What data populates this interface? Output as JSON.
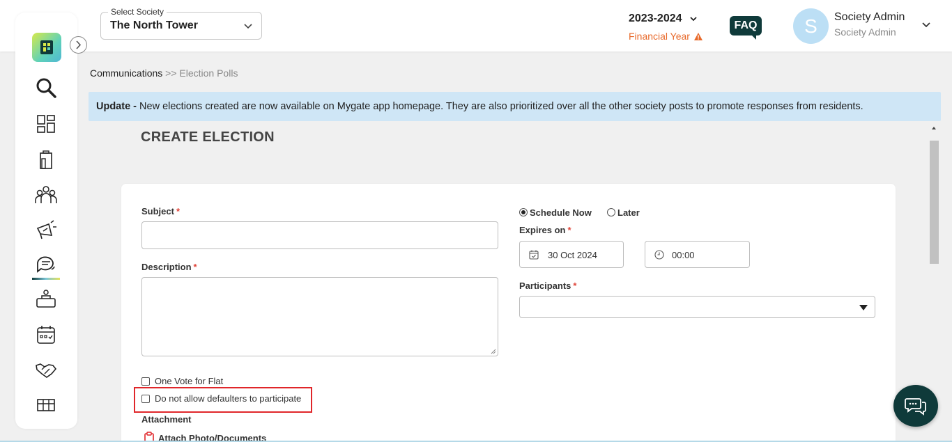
{
  "header": {
    "society_select_label": "Select Society",
    "society_select_value": "The North Tower",
    "financial_year_value": "2023-2024",
    "financial_year_label": "Financial Year",
    "faq_label": "FAQ",
    "avatar_initial": "S",
    "user_name": "Society Admin",
    "user_role": "Society Admin"
  },
  "sidebar": {
    "items": [
      {
        "icon": "search-icon"
      },
      {
        "icon": "dashboard-icon"
      },
      {
        "icon": "building-icon"
      },
      {
        "icon": "residents-icon"
      },
      {
        "icon": "announcement-icon"
      },
      {
        "icon": "communications-icon",
        "active": true
      },
      {
        "icon": "helpdesk-icon"
      },
      {
        "icon": "calendar-icon"
      },
      {
        "icon": "handshake-icon"
      },
      {
        "icon": "amenities-icon"
      }
    ]
  },
  "breadcrumb": {
    "parent": "Communications",
    "current": ">> Election Polls"
  },
  "banner": {
    "prefix": "Update -",
    "text": " New elections created are now available on Mygate app homepage. They are also prioritized over all the other society posts to promote responses from residents."
  },
  "page": {
    "title": "CREATE ELECTION"
  },
  "form": {
    "subject_label": "Subject",
    "subject_value": "",
    "description_label": "Description",
    "description_value": "",
    "schedule_now_label": "Schedule Now",
    "later_label": "Later",
    "schedule_selected": "Schedule Now",
    "expires_label": "Expires on",
    "expires_date": "30 Oct 2024",
    "expires_time": "00:00",
    "participants_label": "Participants",
    "participants_value": "",
    "one_vote_label": "One Vote for Flat",
    "one_vote_checked": false,
    "defaulters_label": "Do not allow defaulters to participate",
    "defaulters_checked": false,
    "attachment_label": "Attachment",
    "attach_button_label": "Attach Photo/Documents",
    "required_marker": "*"
  },
  "colors": {
    "brand_dark": "#0f3a3a",
    "banner_bg": "#cfe6f6",
    "warning": "#e8692a",
    "required": "#e0453a",
    "highlight": "#e0262a"
  }
}
